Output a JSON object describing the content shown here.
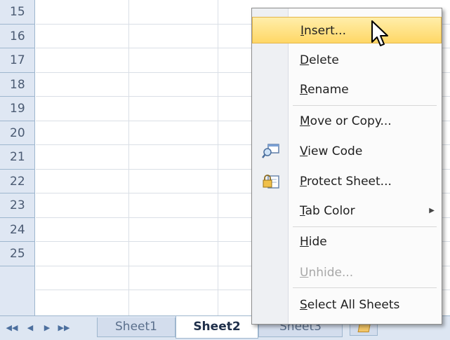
{
  "grid": {
    "row_numbers": [
      "15",
      "16",
      "17",
      "18",
      "19",
      "20",
      "21",
      "22",
      "23",
      "24",
      "25"
    ]
  },
  "tabbar": {
    "nav_first": "◀◀",
    "nav_prev": "◀",
    "nav_next": "▶",
    "nav_last": "▶▶",
    "tabs": [
      "Sheet1",
      "Sheet2",
      "Sheet3"
    ],
    "active_tab": "Sheet2"
  },
  "context_menu": {
    "items": [
      {
        "label": "Insert...",
        "accel": "I",
        "rest": "nsert...",
        "state": "hover"
      },
      {
        "label": "Delete",
        "accel": "D",
        "rest": "elete",
        "state": "normal"
      },
      {
        "label": "Rename",
        "accel": "R",
        "rest": "ename",
        "state": "normal"
      },
      {
        "label": "Move or Copy...",
        "accel": "M",
        "rest": "ove or Copy...",
        "state": "normal"
      },
      {
        "label": "View Code",
        "accel": "V",
        "rest": "iew Code",
        "state": "normal",
        "icon": "view-code-icon"
      },
      {
        "label": "Protect Sheet...",
        "accel": "P",
        "rest": "rotect Sheet...",
        "state": "normal",
        "icon": "protect-sheet-icon"
      },
      {
        "label": "Tab Color",
        "accel": "T",
        "rest": "ab Color",
        "state": "normal",
        "submenu": true
      },
      {
        "label": "Hide",
        "accel": "H",
        "rest": "ide",
        "state": "normal"
      },
      {
        "label": "Unhide...",
        "accel": "U",
        "rest": "nhide...",
        "state": "disabled"
      },
      {
        "label": "Select All Sheets",
        "accel": "S",
        "rest": "elect All Sheets",
        "state": "normal"
      }
    ]
  },
  "colors": {
    "hover_fill": "#ffd766",
    "header_fill": "#dfe7f3",
    "tabbar_fill": "#dde6f2"
  }
}
